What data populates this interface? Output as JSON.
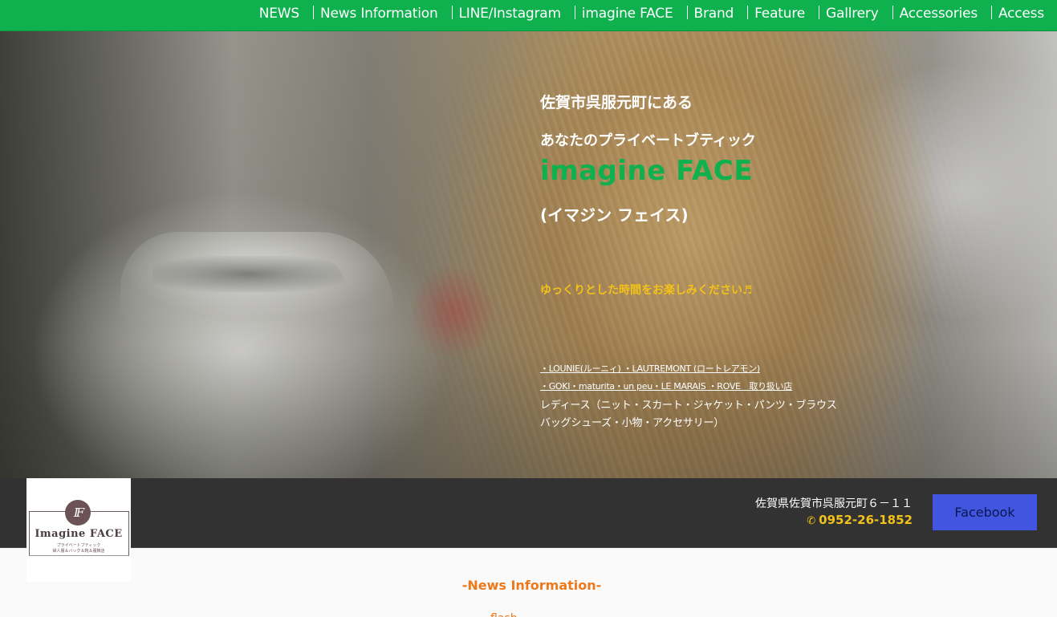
{
  "nav": {
    "items": [
      "NEWS",
      "News Information",
      "LINE/Instagram",
      "imagine FACE",
      "Brand",
      "Feature",
      "Gallrery",
      "Accessories",
      "Access"
    ]
  },
  "hero": {
    "line1": "佐賀市呉服元町にある",
    "line2": "あなたのプライベートブティック",
    "brand": "imagine FACE",
    "kana": "(イマジン フェイス)",
    "relax": "ゆっくりとした時間をお楽しみください♬",
    "brands_line1": "・LOUNIE(ルーニィ) ・LAUTREMONT (ロートレアモン)",
    "brands_line2": "・GOKI・maturita・un peu・LE MARAIS ・ROVE　取り扱い店",
    "items_line1": "レディース（ニット・スカート・ジャケット・パンツ・ブラウス",
    "items_line2": "バッグシューズ・小物・アクセサリー）"
  },
  "logo": {
    "monogram": "IF",
    "name": "Imagine FACE",
    "sub1": "プライベートブティック",
    "sub2": "婦人服＆バッグ＆靴＆服飾店"
  },
  "info": {
    "address": "佐賀県佐賀市呉服元町６－１１",
    "phone": "0952-26-1852",
    "phone_icon": "phone-icon",
    "facebook_label": "Facebook"
  },
  "news": {
    "title": "-News Information-"
  },
  "colors": {
    "nav_green": "#0fb04e",
    "brand_green": "#0fb04e",
    "accent_yellow": "#f2c21a",
    "orange": "#ec7a1c",
    "facebook_blue": "#4155e0",
    "dark_bar": "#323232"
  }
}
